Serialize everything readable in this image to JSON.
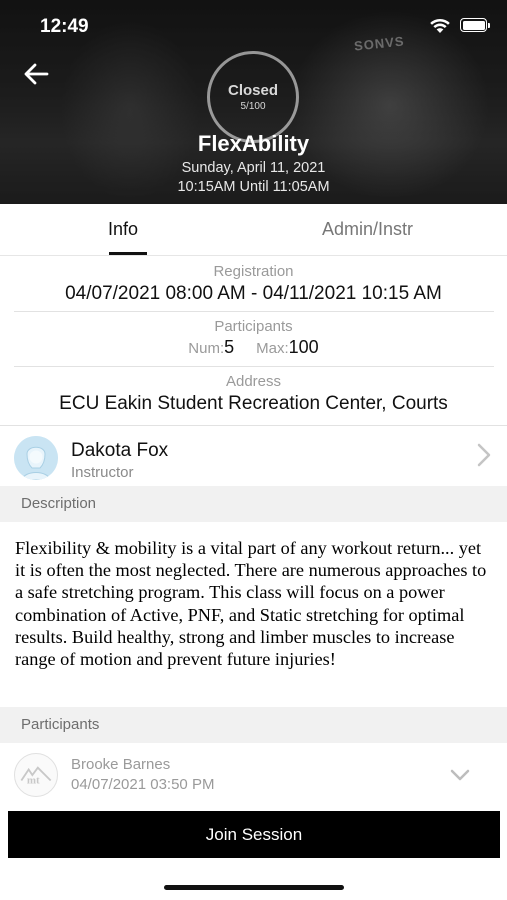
{
  "status_bar": {
    "time": "12:49"
  },
  "header": {
    "capacity_status": "Closed",
    "capacity_count": "5/100",
    "title": "FlexAbility",
    "date": "Sunday, April 11, 2021",
    "time_range": "10:15AM Until 11:05AM"
  },
  "tabs": [
    {
      "label": "Info",
      "active": true
    },
    {
      "label": "Admin/Instr",
      "active": false
    }
  ],
  "info": {
    "registration_label": "Registration",
    "registration_value": "04/07/2021 08:00 AM - 04/11/2021 10:15 AM",
    "participants_label": "Participants",
    "num_label": "Num:",
    "num_value": "5",
    "max_label": "Max:",
    "max_value": "100",
    "address_label": "Address",
    "address_value": "ECU Eakin Student Recreation Center, Courts"
  },
  "instructor": {
    "name": "Dakota Fox",
    "role": "Instructor"
  },
  "description": {
    "header": "Description",
    "text": "Flexibility & mobility is a vital part of any workout return... yet it is often the most neglected. There are numerous approaches to a safe stretching program. This class will focus on a power combination of Active, PNF, and Static stretching for optimal results. Build healthy, strong and limber muscles to increase range of motion and prevent future injuries!"
  },
  "participants_section": {
    "header": "Participants",
    "items": [
      {
        "name": "Brooke Barnes",
        "date": "04/07/2021 03:50 PM"
      }
    ]
  },
  "join_button": {
    "label": "Join Session"
  },
  "icons": {
    "back": "arrow-left-icon",
    "wifi": "wifi-icon",
    "battery": "battery-icon",
    "chevron_right": "chevron-right-icon",
    "chevron_down": "chevron-down-icon",
    "avatar": "user-avatar-icon",
    "participant_logo": "ecu-logo-icon"
  },
  "colors": {
    "header_bg": "#2a2a2a",
    "button_bg": "#000000",
    "avatar_bg": "#c9e4f3",
    "section_bg": "#f1f1f1"
  }
}
